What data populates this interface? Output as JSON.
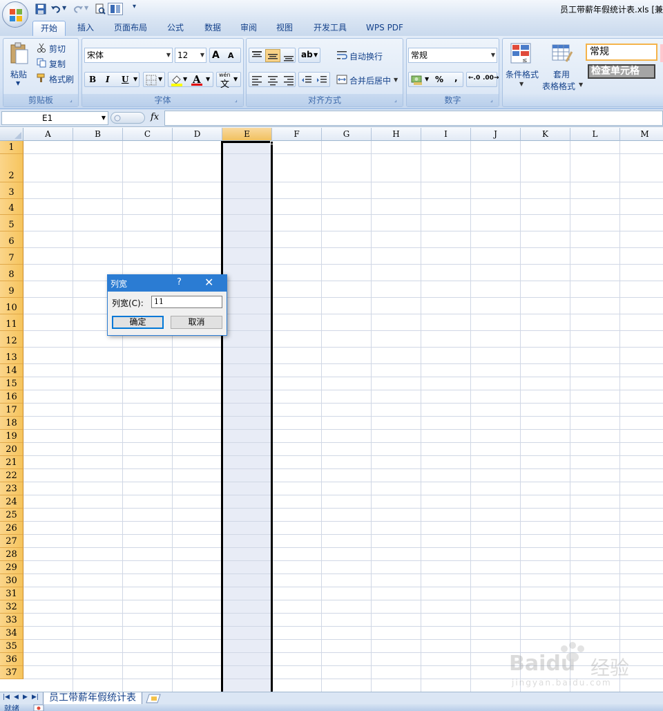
{
  "app": {
    "window_title": "员工带薪年假统计表.xls  [兼",
    "quick_access": [
      "save-icon",
      "undo-icon",
      "redo-icon",
      "print-preview-icon",
      "toolbar-customize-icon"
    ]
  },
  "ribbon_tabs": [
    {
      "label": "开始",
      "active": true
    },
    {
      "label": "插入"
    },
    {
      "label": "页面布局"
    },
    {
      "label": "公式"
    },
    {
      "label": "数据"
    },
    {
      "label": "审阅"
    },
    {
      "label": "视图"
    },
    {
      "label": "开发工具"
    },
    {
      "label": "WPS PDF"
    }
  ],
  "ribbon": {
    "clipboard": {
      "paste": "粘贴",
      "cut": "剪切",
      "copy": "复制",
      "format_painter": "格式刷",
      "group_label": "剪贴板"
    },
    "font": {
      "font_name": "宋体",
      "font_size": "12",
      "group_label": "字体",
      "grow": "A",
      "shrink": "A",
      "bold": "B",
      "italic": "I",
      "underline": "U",
      "font_color_glyph": "A",
      "phonetic": "wén"
    },
    "alignment": {
      "wrap_text": "自动换行",
      "merge_center": "合并后居中",
      "group_label": "对齐方式"
    },
    "number": {
      "format": "常规",
      "percent": "%",
      "comma": ",",
      "group_label": "数字"
    },
    "styles": {
      "conditional_format": "条件格式",
      "table_format_1": "套用",
      "table_format_2": "表格格式",
      "style_normal": "常规",
      "style_check_cell": "检查单元格"
    }
  },
  "formula_bar": {
    "name_box": "E1",
    "fx": "fx",
    "formula": ""
  },
  "columns": [
    "A",
    "B",
    "C",
    "D",
    "E",
    "F",
    "G",
    "H",
    "I",
    "J",
    "K",
    "L",
    "M"
  ],
  "selected_column": "E",
  "rows": [
    "1",
    "2",
    "3",
    "4",
    "5",
    "6",
    "7",
    "8",
    "9",
    "10",
    "11",
    "12",
    "13",
    "14",
    "15",
    "16",
    "17",
    "18",
    "19",
    "20",
    "21",
    "22",
    "23",
    "24",
    "25",
    "26",
    "27",
    "28",
    "29",
    "30",
    "31",
    "32",
    "33",
    "34",
    "35",
    "36",
    "37"
  ],
  "sheet_tabs": [
    {
      "label": "员工带薪年假统计表",
      "active": true
    }
  ],
  "status": {
    "text": "就绪"
  },
  "dialog": {
    "title": "列宽",
    "help": "?",
    "close": "✕",
    "field_label": "列宽(C):",
    "value": "11",
    "ok": "确定",
    "cancel": "取消"
  },
  "watermark": {
    "brand": "Baidu",
    "brand_cn": "经验",
    "url": "jingyan.baidu.com"
  }
}
